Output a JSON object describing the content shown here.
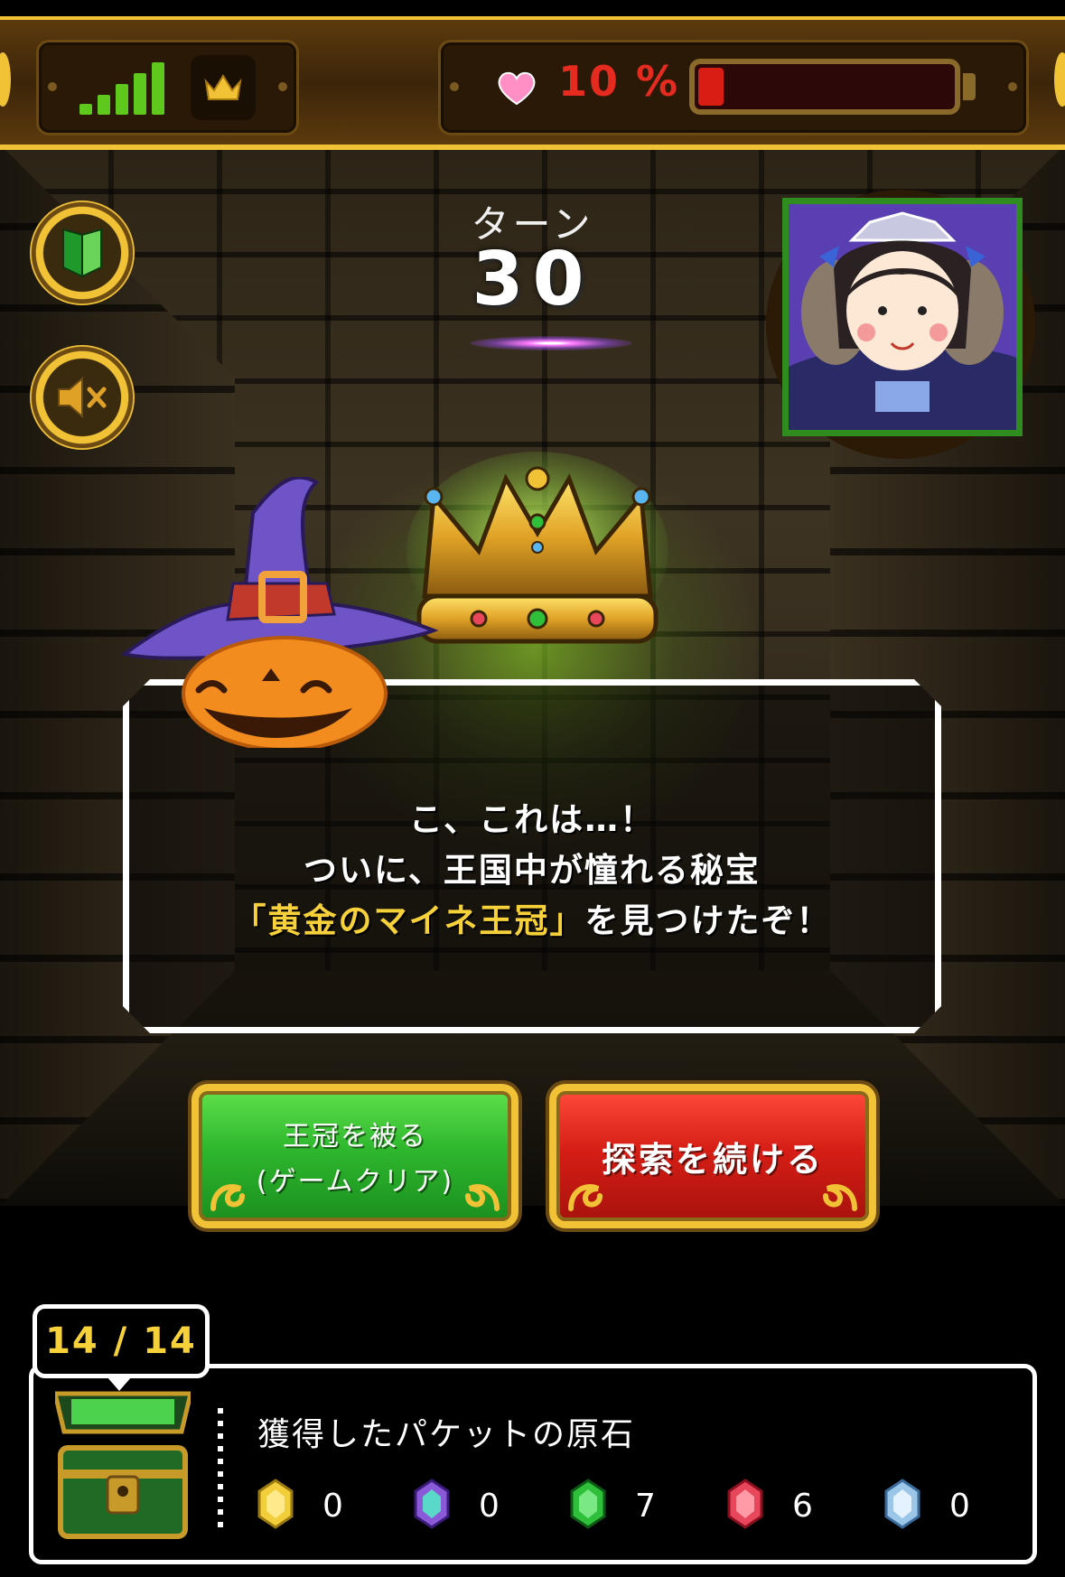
{
  "hud": {
    "battery_percent_label": "10 %",
    "battery_level": 0.1,
    "signal_icon": "signal-bars-icon",
    "crown_icon": "crown-icon",
    "heart_icon": "heart-icon",
    "colors": {
      "accent_gold": "#f2c236",
      "battery_red": "#d81e14",
      "signal_green": "#5ec81d"
    }
  },
  "side_buttons": [
    {
      "icon": "beginner-mark-icon"
    },
    {
      "icon": "sound-muted-icon"
    }
  ],
  "turn": {
    "label": "ターン",
    "value": "30"
  },
  "dialog": {
    "line1": "こ、これは…！",
    "line2": "ついに、王国中が憧れる秘宝",
    "line3_gold": "「黄金のマイネ王冠」",
    "line3_rest": "を見つけたぞ！"
  },
  "actions": {
    "wear_crown": {
      "line1": "王冠を被る",
      "line2": "(ゲームクリア)",
      "color": "#2eb72e"
    },
    "continue_explore": {
      "label": "探索を続ける",
      "color": "#d61e16"
    }
  },
  "inventory": {
    "counter": "14 / 14",
    "title": "獲得したパケットの原石",
    "gems": [
      {
        "icon": "yellow-gem-icon",
        "color": "#f2cf3a",
        "count": "0"
      },
      {
        "icon": "purple-gem-icon",
        "color": "#8a5ad8",
        "count": "0"
      },
      {
        "icon": "green-gem-icon",
        "color": "#2fbf3a",
        "count": "7"
      },
      {
        "icon": "red-gem-icon",
        "color": "#e8465a",
        "count": "6"
      },
      {
        "icon": "blue-gem-icon",
        "color": "#9cc6e8",
        "count": "0"
      }
    ]
  }
}
